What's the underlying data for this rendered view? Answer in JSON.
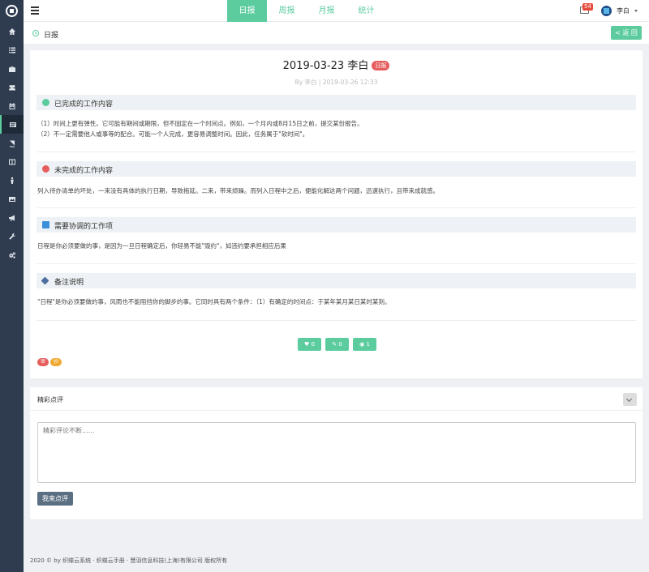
{
  "topbar": {
    "tabs": [
      {
        "label": "日报",
        "active": true
      },
      {
        "label": "周报",
        "active": false
      },
      {
        "label": "月报",
        "active": false
      },
      {
        "label": "统计",
        "active": false
      }
    ],
    "mail_count": "54",
    "user_name": "李白"
  },
  "breadcrumb": {
    "title": "日报",
    "back_label": "< 返 回"
  },
  "report": {
    "title": "2019-03-23 李白",
    "badge": "日报",
    "meta": "By 李白 | 2019-03-26 12:33",
    "sections": [
      {
        "title": "已完成的工作内容",
        "icon": "check-circle-icon",
        "icon_color": "#5ccc9f",
        "lines": [
          "（1）时间上更有弹性。它可能有期间或期限，但不固定在一个时间点。例如，一个月内或8月15日之前，提交某份报告。",
          "（2）不一定需要他人或事等的配合。可能一个人完成，更容易调整时间。因此，任务属于\"软时间\"。"
        ]
      },
      {
        "title": "未完成的工作内容",
        "icon": "alert-circle-icon",
        "icon_color": "#e55d5d",
        "lines": [
          "列入待办清单的坏处，一来没有具体的执行日期，导致拖延。二来，带来烦躁。而列入日程中之后，便能化解这两个问题，迅速执行，且带来成就感。"
        ]
      },
      {
        "title": "需要协调的工作项",
        "icon": "h-square-icon",
        "icon_color": "#3a8fd9",
        "lines": [
          "日程是你必须要做的事，是因为一旦日程确定后，你轻易不能\"毁约\"，如违约要承担相应后果"
        ]
      },
      {
        "title": "备注说明",
        "icon": "tags-icon",
        "icon_color": "#4d6f9f",
        "lines": [
          "\"日程\"是你必须要做的事，风雨也不能阻挡你的脚步的事。它同时具有两个条件：（1）有确定的时间点：于某年某月某日某时某刻。"
        ]
      }
    ],
    "actions": {
      "likes": "0",
      "comments": "0",
      "views": "1"
    },
    "tags": [
      {
        "label": "审",
        "color": "#e55d5d"
      },
      {
        "label": "抄",
        "color": "#f0a830"
      }
    ]
  },
  "comments": {
    "title": "精彩点评",
    "placeholder": "精彩评论不断......",
    "submit_label": "我来点评"
  },
  "footer": {
    "text": "2020 © by 织蝶云系统 · 织蝶云手册 · 慧羽信息科技(上海)有限公司 版权所有"
  }
}
